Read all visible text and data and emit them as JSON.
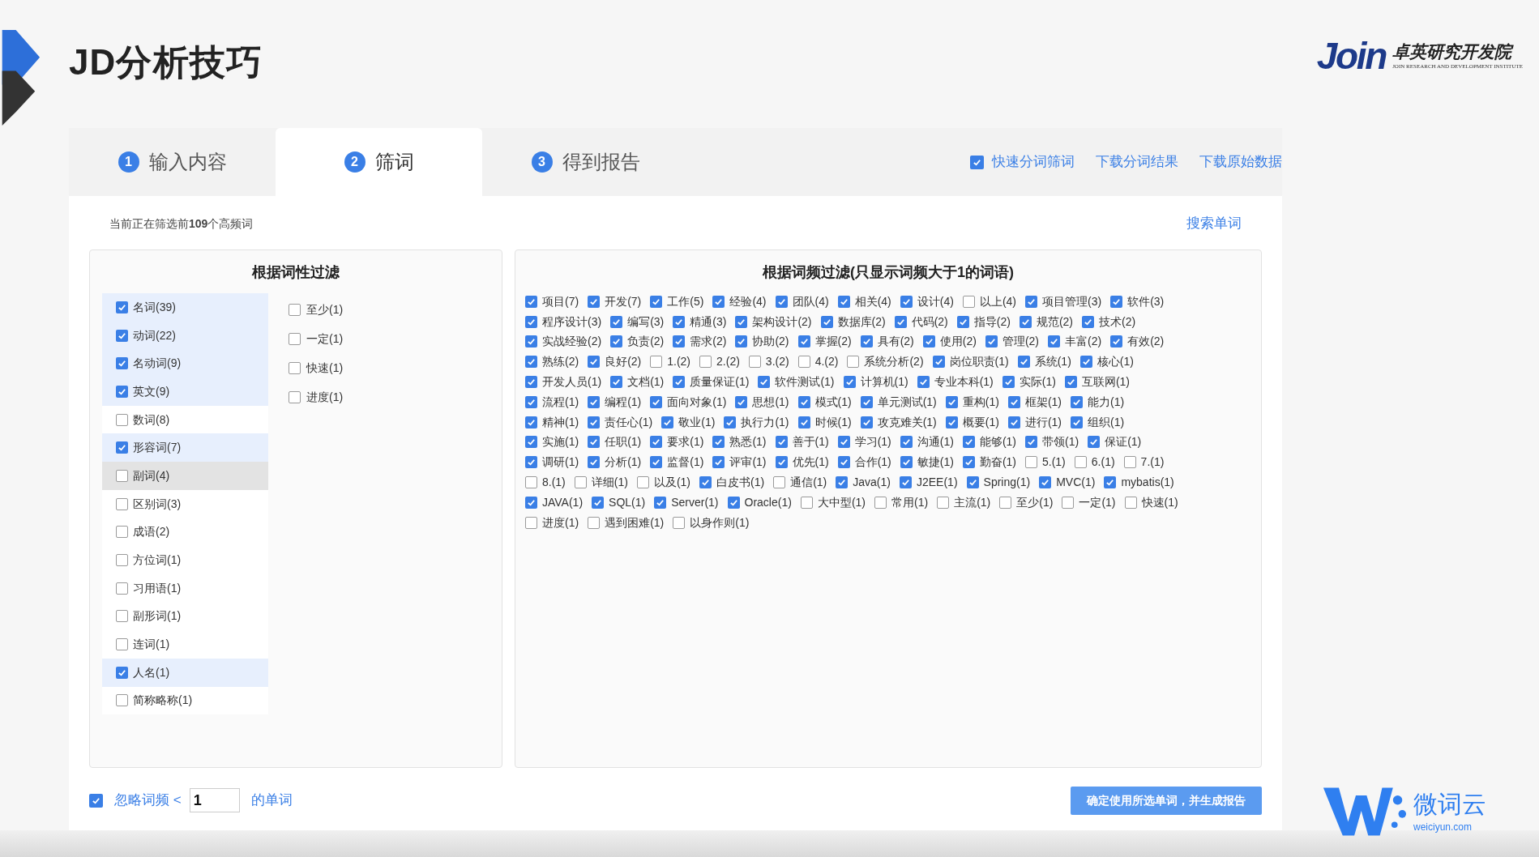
{
  "slide_title": "JD分析技巧",
  "brand": {
    "mark": "Join",
    "name": "卓英研究开发院",
    "subtitle": "JOIN RESEARCH AND DEVELOPMENT INSTITUTE"
  },
  "tabs": [
    {
      "number": "1",
      "label": "输入内容",
      "selected": false
    },
    {
      "number": "2",
      "label": "筛词",
      "selected": true
    },
    {
      "number": "3",
      "label": "得到报告",
      "selected": false
    }
  ],
  "toolbar": {
    "quick_split": {
      "label": "快速分词筛词",
      "checked": true
    },
    "links": [
      "下载分词结果",
      "下载原始数据"
    ]
  },
  "status": "当前正在筛选前**109**个高频词",
  "search_link": "搜索单词",
  "pos_panel": {
    "title": "根据词性过滤",
    "categories": [
      {
        "label": "名词(39)",
        "checked": true,
        "hovered": false
      },
      {
        "label": "动词(22)",
        "checked": true,
        "hovered": false
      },
      {
        "label": "名动词(9)",
        "checked": true,
        "hovered": false
      },
      {
        "label": "英文(9)",
        "checked": true,
        "hovered": false
      },
      {
        "label": "数词(8)",
        "checked": false,
        "hovered": false
      },
      {
        "label": "形容词(7)",
        "checked": true,
        "hovered": false
      },
      {
        "label": "副词(4)",
        "checked": false,
        "hovered": true
      },
      {
        "label": "区别词(3)",
        "checked": false,
        "hovered": false
      },
      {
        "label": "成语(2)",
        "checked": false,
        "hovered": false
      },
      {
        "label": "方位词(1)",
        "checked": false,
        "hovered": false
      },
      {
        "label": "习用语(1)",
        "checked": false,
        "hovered": false
      },
      {
        "label": "副形词(1)",
        "checked": false,
        "hovered": false
      },
      {
        "label": "连词(1)",
        "checked": false,
        "hovered": false
      },
      {
        "label": "人名(1)",
        "checked": true,
        "hovered": false
      },
      {
        "label": "简称略称(1)",
        "checked": false,
        "hovered": false
      }
    ],
    "words": [
      {
        "label": "至少(1)",
        "checked": false
      },
      {
        "label": "一定(1)",
        "checked": false
      },
      {
        "label": "快速(1)",
        "checked": false
      },
      {
        "label": "进度(1)",
        "checked": false
      }
    ]
  },
  "freq_panel": {
    "title": "根据词频过滤(只显示词频大于1的词语)",
    "lines": [
      {
        "words": [
          {
            "label": "项目(7)",
            "checked": true
          },
          {
            "label": "开发(7)",
            "checked": true
          },
          {
            "label": "工作(5)",
            "checked": true
          },
          {
            "label": "经验(4)",
            "checked": true
          },
          {
            "label": "团队(4)",
            "checked": true
          },
          {
            "label": "相关(4)",
            "checked": true
          },
          {
            "label": "设计(4)",
            "checked": true
          },
          {
            "label": "以上(4)",
            "checked": false
          },
          {
            "label": "项目管理(3)",
            "checked": true
          },
          {
            "label": "软件(3)",
            "checked": true
          }
        ]
      },
      {
        "words": [
          {
            "label": "程序设计(3)",
            "checked": true
          },
          {
            "label": "编写(3)",
            "checked": true
          },
          {
            "label": "精通(3)",
            "checked": true
          },
          {
            "label": "架构设计(2)",
            "checked": true
          },
          {
            "label": "数据库(2)",
            "checked": true
          },
          {
            "label": "代码(2)",
            "checked": true
          },
          {
            "label": "指导(2)",
            "checked": true
          },
          {
            "label": "规范(2)",
            "checked": true
          },
          {
            "label": "技术(2)",
            "checked": true
          }
        ]
      },
      {
        "words": [
          {
            "label": "实战经验(2)",
            "checked": true
          },
          {
            "label": "负责(2)",
            "checked": true
          },
          {
            "label": "需求(2)",
            "checked": true
          },
          {
            "label": "协助(2)",
            "checked": true
          },
          {
            "label": "掌握(2)",
            "checked": true
          },
          {
            "label": "具有(2)",
            "checked": true
          },
          {
            "label": "使用(2)",
            "checked": true
          },
          {
            "label": "管理(2)",
            "checked": true
          },
          {
            "label": "丰富(2)",
            "checked": true
          },
          {
            "label": "有效(2)",
            "checked": true
          }
        ]
      },
      {
        "words": [
          {
            "label": "熟练(2)",
            "checked": true
          },
          {
            "label": "良好(2)",
            "checked": true
          },
          {
            "label": "1.(2)",
            "checked": false
          },
          {
            "label": "2.(2)",
            "checked": false
          },
          {
            "label": "3.(2)",
            "checked": false
          },
          {
            "label": "4.(2)",
            "checked": false
          },
          {
            "label": "系统分析(2)",
            "checked": false
          },
          {
            "label": "岗位职责(1)",
            "checked": true
          },
          {
            "label": "系统(1)",
            "checked": true
          },
          {
            "label": "核心(1)",
            "checked": true
          }
        ]
      },
      {
        "words": [
          {
            "label": "开发人员(1)",
            "checked": true
          },
          {
            "label": "文档(1)",
            "checked": true
          },
          {
            "label": "质量保证(1)",
            "checked": true
          },
          {
            "label": "软件测试(1)",
            "checked": true
          },
          {
            "label": "计算机(1)",
            "checked": true
          },
          {
            "label": "专业本科(1)",
            "checked": true
          },
          {
            "label": "实际(1)",
            "checked": true
          },
          {
            "label": "互联网(1)",
            "checked": true
          }
        ]
      },
      {
        "words": [
          {
            "label": "流程(1)",
            "checked": true
          },
          {
            "label": "编程(1)",
            "checked": true
          },
          {
            "label": "面向对象(1)",
            "checked": true
          },
          {
            "label": "思想(1)",
            "checked": true
          },
          {
            "label": "模式(1)",
            "checked": true
          },
          {
            "label": "单元测试(1)",
            "checked": true
          },
          {
            "label": "重构(1)",
            "checked": true
          },
          {
            "label": "框架(1)",
            "checked": true
          },
          {
            "label": "能力(1)",
            "checked": true
          }
        ]
      },
      {
        "words": [
          {
            "label": "精神(1)",
            "checked": true
          },
          {
            "label": "责任心(1)",
            "checked": true
          },
          {
            "label": "敬业(1)",
            "checked": true
          },
          {
            "label": "执行力(1)",
            "checked": true
          },
          {
            "label": "时候(1)",
            "checked": true
          },
          {
            "label": "攻克难关(1)",
            "checked": true
          },
          {
            "label": "概要(1)",
            "checked": true
          },
          {
            "label": "进行(1)",
            "checked": true
          },
          {
            "label": "组织(1)",
            "checked": true
          }
        ]
      },
      {
        "words": [
          {
            "label": "实施(1)",
            "checked": true
          },
          {
            "label": "任职(1)",
            "checked": true
          },
          {
            "label": "要求(1)",
            "checked": true
          },
          {
            "label": "熟悉(1)",
            "checked": true
          },
          {
            "label": "善于(1)",
            "checked": true
          },
          {
            "label": "学习(1)",
            "checked": true
          },
          {
            "label": "沟通(1)",
            "checked": true
          },
          {
            "label": "能够(1)",
            "checked": true
          },
          {
            "label": "带领(1)",
            "checked": true
          },
          {
            "label": "保证(1)",
            "checked": true
          }
        ]
      },
      {
        "words": [
          {
            "label": "调研(1)",
            "checked": true
          },
          {
            "label": "分析(1)",
            "checked": true
          },
          {
            "label": "监督(1)",
            "checked": true
          },
          {
            "label": "评审(1)",
            "checked": true
          },
          {
            "label": "优先(1)",
            "checked": true
          },
          {
            "label": "合作(1)",
            "checked": true
          },
          {
            "label": "敏捷(1)",
            "checked": true
          },
          {
            "label": "勤奋(1)",
            "checked": true
          },
          {
            "label": "5.(1)",
            "checked": false
          },
          {
            "label": "6.(1)",
            "checked": false
          },
          {
            "label": "7.(1)",
            "checked": false
          }
        ]
      },
      {
        "words": [
          {
            "label": "8.(1)",
            "checked": false
          },
          {
            "label": "详细(1)",
            "checked": false
          },
          {
            "label": "以及(1)",
            "checked": false
          },
          {
            "label": "白皮书(1)",
            "checked": true
          },
          {
            "label": "通信(1)",
            "checked": false
          },
          {
            "label": "Java(1)",
            "checked": true
          },
          {
            "label": "J2EE(1)",
            "checked": true
          },
          {
            "label": "Spring(1)",
            "checked": true
          },
          {
            "label": "MVC(1)",
            "checked": true
          },
          {
            "label": "mybatis(1)",
            "checked": true
          }
        ]
      },
      {
        "words": [
          {
            "label": "JAVA(1)",
            "checked": true
          },
          {
            "label": "SQL(1)",
            "checked": true
          },
          {
            "label": "Server(1)",
            "checked": true
          },
          {
            "label": "Oracle(1)",
            "checked": true
          },
          {
            "label": "大中型(1)",
            "checked": false
          },
          {
            "label": "常用(1)",
            "checked": false
          },
          {
            "label": "主流(1)",
            "checked": false
          },
          {
            "label": "至少(1)",
            "checked": false
          },
          {
            "label": "一定(1)",
            "checked": false
          },
          {
            "label": "快速(1)",
            "checked": false
          }
        ]
      },
      {
        "words": [
          {
            "label": "进度(1)",
            "checked": false
          },
          {
            "label": "遇到困难(1)",
            "checked": false
          },
          {
            "label": "以身作则(1)",
            "checked": false
          }
        ]
      }
    ]
  },
  "footer": {
    "ignore": {
      "checked": true,
      "label": "忽略词频 <",
      "value": "1",
      "suffix": "的单词"
    },
    "submit": "确定使用所选单词，并生成报告"
  },
  "watermark_brand": {
    "name": "微词云",
    "domain": "weiciyun.com"
  }
}
